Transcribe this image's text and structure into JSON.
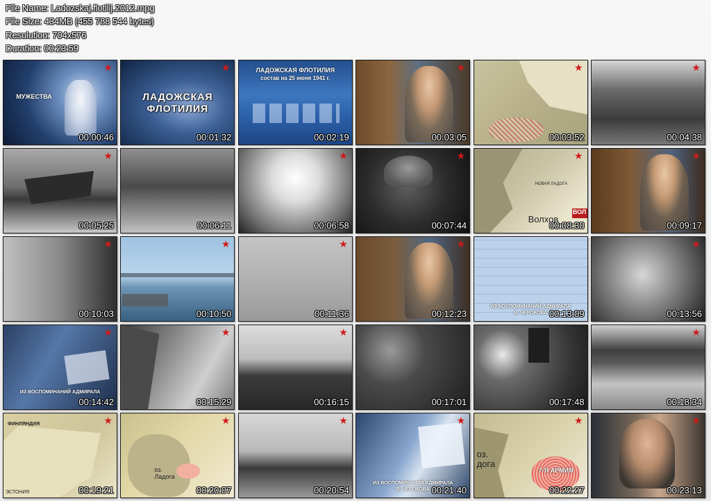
{
  "header": {
    "file_name": "File Name: Ladozskaj.flotilij.2012.mpg",
    "file_size": "File Size: 434MB (455 788 544 bytes)",
    "resolution": "Resolution: 704x576",
    "duration": "Duration: 00:23:59"
  },
  "colors": {
    "star_red": "#d11a1a",
    "timestamp_text": "#ffffff"
  },
  "icons": {
    "star": "red-star-icon"
  },
  "thumbnails": [
    {
      "time": "00:00:46",
      "caption": "МУЖЕСТВА"
    },
    {
      "time": "00:01:32",
      "caption": "ЛАДОЖСКАЯ ФЛОТИЛИЯ"
    },
    {
      "time": "00:02:19",
      "caption": "ЛАДОЖСКАЯ ФЛОТИЛИЯ",
      "subcaption": "состав на 25 июня 1941 г."
    },
    {
      "time": "00:03:05"
    },
    {
      "time": "00:03:52"
    },
    {
      "time": "00:04:38"
    },
    {
      "time": "00:05:25"
    },
    {
      "time": "00:06:11"
    },
    {
      "time": "00:06:58"
    },
    {
      "time": "00:07:44"
    },
    {
      "time": "00:08:30",
      "caption": "Волхов",
      "subcaption": "НОВАЯ ЛАДОГА",
      "extra": "ВОЛ"
    },
    {
      "time": "00:09:17"
    },
    {
      "time": "00:10:03"
    },
    {
      "time": "00:10:50"
    },
    {
      "time": "00:11:36"
    },
    {
      "time": "00:12:23"
    },
    {
      "time": "00:13:09",
      "caption": "ИЗ ВОСПОМИНАНИЙ АДМИРАЛА",
      "subcaption": "В. ЧЕРОКОВА"
    },
    {
      "time": "00:13:56"
    },
    {
      "time": "00:14:42",
      "caption": "ИЗ ВОСПОМИНАНИЙ АДМИРАЛА"
    },
    {
      "time": "00:15:29"
    },
    {
      "time": "00:16:15"
    },
    {
      "time": "00:17:01"
    },
    {
      "time": "00:17:48"
    },
    {
      "time": "00:18:34"
    },
    {
      "time": "00:19:21",
      "caption": "ФИНЛЯНДИЯ",
      "subcaption": "ЭСТОНИЯ"
    },
    {
      "time": "00:20:07",
      "caption": "оз. Ладога"
    },
    {
      "time": "00:20:54"
    },
    {
      "time": "00:21:40",
      "caption": "ИЗ ВОСПОМИНАНИЙ АДМИРАЛА",
      "subcaption": "В. ЧЕРОКОВА"
    },
    {
      "time": "00:22:27",
      "caption": "оз. дога",
      "subcaption": "7-Я АРМИЯ"
    },
    {
      "time": "00:23:13"
    }
  ]
}
